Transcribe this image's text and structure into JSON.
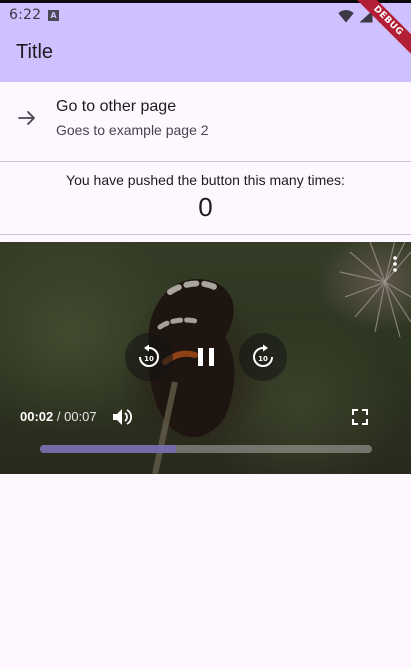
{
  "status_bar": {
    "time": "6:22",
    "notification_glyph": "A",
    "icons": [
      "wifi-icon",
      "signal-icon",
      "battery-icon"
    ]
  },
  "app_bar": {
    "title": "Title",
    "background_color": "#cfc1ff"
  },
  "debug_banner": {
    "label": "DEBUG",
    "color": "#b21e35"
  },
  "nav_tile": {
    "icon": "arrow-forward-icon",
    "title": "Go to other page",
    "subtitle": "Goes to example page 2"
  },
  "counter": {
    "label": "You have pushed the button this many times:",
    "value": "0"
  },
  "video_player": {
    "position": "00:02",
    "separator": " / ",
    "duration": "00:07",
    "played_fraction": 0.41,
    "buffered_fraction": 0.41,
    "controls": {
      "rewind_seconds": "10",
      "forward_seconds": "10",
      "state": "playing"
    },
    "accent_color": "#6e64aa"
  }
}
